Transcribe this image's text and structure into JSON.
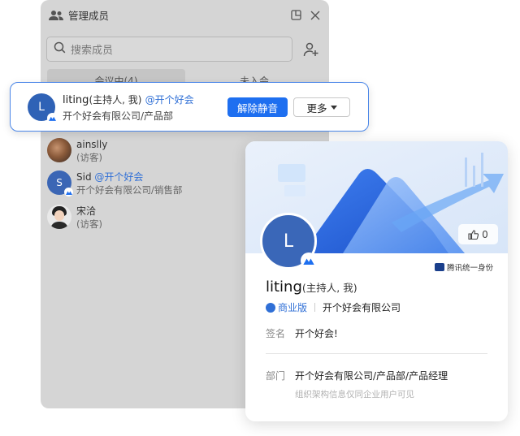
{
  "panel": {
    "title": "管理成员",
    "search_placeholder": "搜索成员",
    "tabs": [
      {
        "label": "会议中(4)"
      },
      {
        "label": "未入会"
      }
    ],
    "members": [
      {
        "name": "ainslly",
        "tag": "",
        "sub": "(访客)",
        "avatar": "photo"
      },
      {
        "name": "Sid",
        "tag": "@开个好会",
        "sub": "开个好会有限公司/销售部",
        "avatar": "S"
      },
      {
        "name": "宋洽",
        "tag": "",
        "sub": "(访客)",
        "avatar": "photo"
      }
    ]
  },
  "highlight": {
    "avatar": "L",
    "name": "liting",
    "role": "(主持人, 我)",
    "tag": "@开个好会",
    "sub": "开个好会有限公司/产品部",
    "unmute_label": "解除静音",
    "more_label": "更多"
  },
  "card": {
    "likes": "0",
    "avatar": "L",
    "identity_label": "腾讯统一身份",
    "name": "liting",
    "role": "(主持人, 我)",
    "edition": "商业版",
    "company": "开个好会有限公司",
    "signature_label": "签名",
    "signature": "开个好会!",
    "dept_label": "部门",
    "dept": "开个好会有限公司/产品部/产品经理",
    "note": "组织架构信息仅同企业用户可见"
  },
  "colors": {
    "accent": "#1e6ff0",
    "tag": "#2f6fd6",
    "avatar": "#3a67b8"
  }
}
